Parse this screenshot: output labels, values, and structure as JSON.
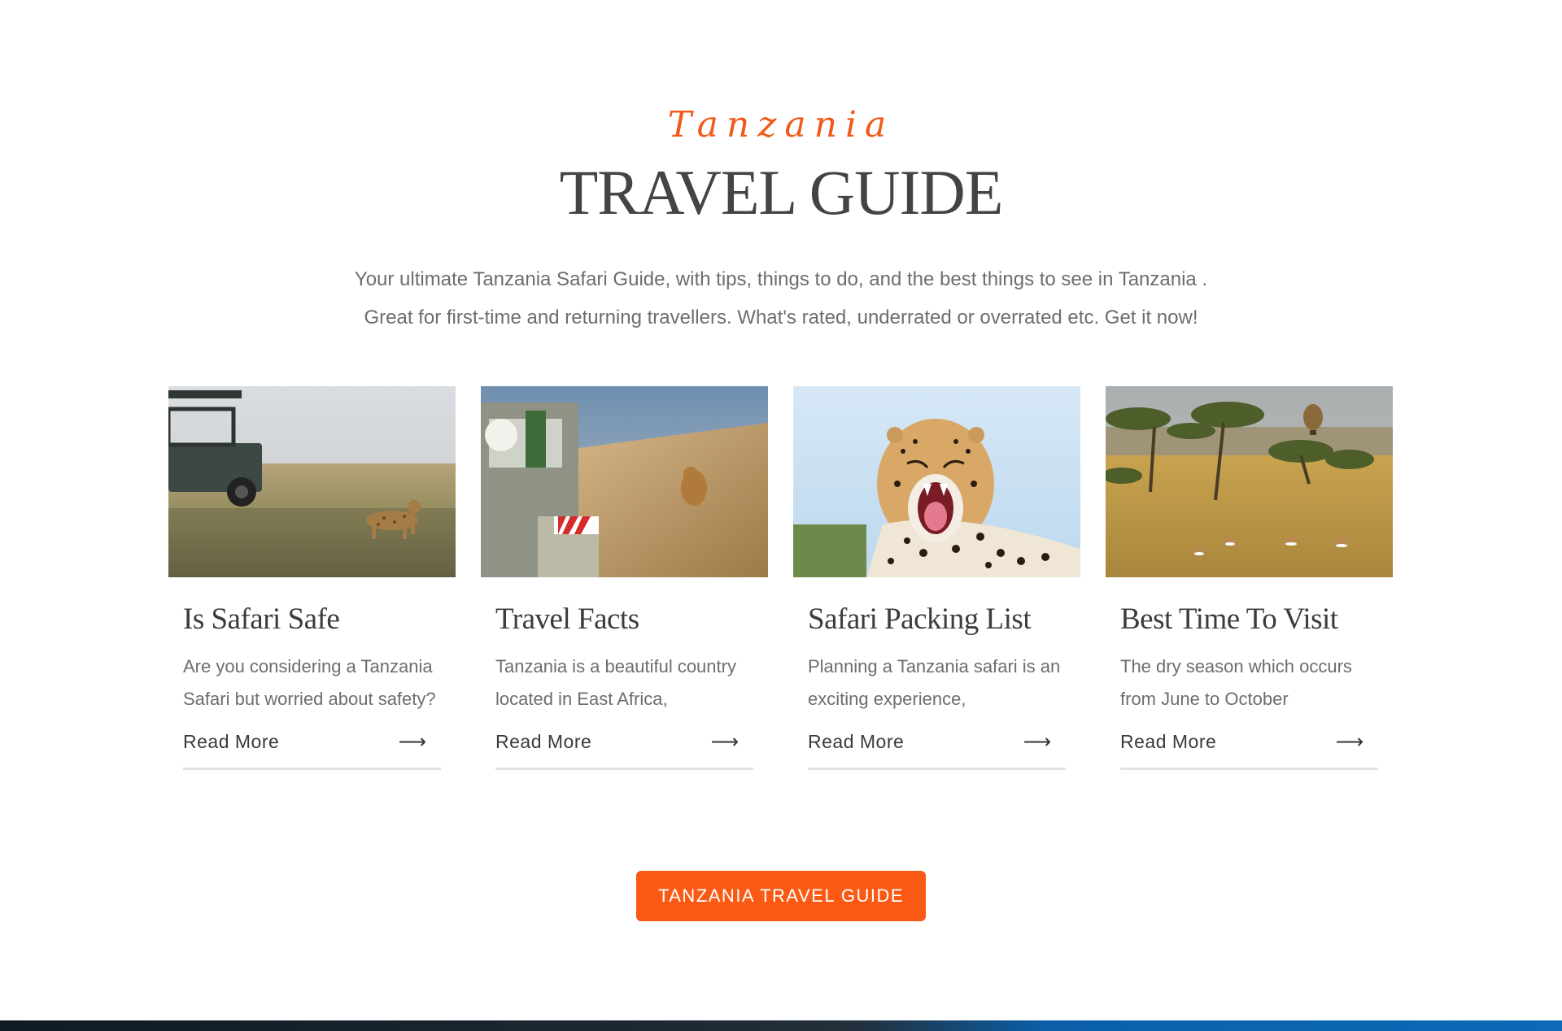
{
  "header": {
    "script_title": "Tanzania",
    "main_title": "TRAVEL GUIDE",
    "intro_line1": "Your ultimate Tanzania Safari Guide, with tips, things to do, and the best things to see in Tanzania .",
    "intro_line2": "Great for first-time and returning travellers. What's rated, underrated or overrated etc. Get it now!"
  },
  "cards": [
    {
      "title": "Is Safari Safe",
      "text": "Are you considering a Tanzania Safari but worried about safety?",
      "link": "Read More",
      "image": "safari-jeep-cheetah"
    },
    {
      "title": "Travel Facts",
      "text": "Tanzania is a beautiful country located in East Africa,",
      "link": "Read More",
      "image": "lioness-in-grass"
    },
    {
      "title": "Safari Packing List",
      "text": "Planning a Tanzania safari is an exciting experience,",
      "link": "Read More",
      "image": "yawning-cheetah"
    },
    {
      "title": "Best Time To Visit",
      "text": "The dry season which occurs from June to October",
      "link": "Read More",
      "image": "savanna-balloon-gazelles"
    }
  ],
  "cta": {
    "label": "TANZANIA TRAVEL GUIDE"
  },
  "colors": {
    "accent": "#fa5a14",
    "heading": "#444444",
    "body_text": "#6d6d6d"
  },
  "icons": {
    "read_more": "arrow-right-icon"
  }
}
